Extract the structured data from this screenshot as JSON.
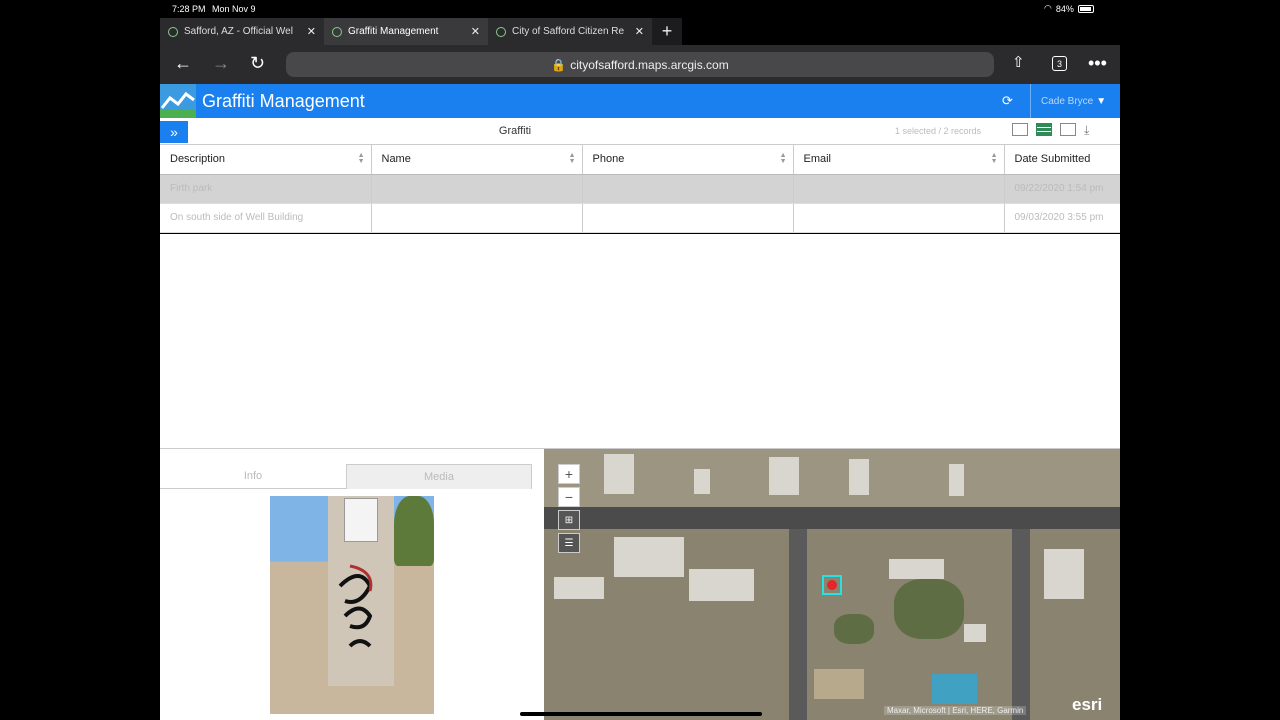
{
  "status": {
    "time": "7:28 PM",
    "date": "Mon Nov 9",
    "battery": "84%"
  },
  "tabs": [
    {
      "label": "Safford, AZ - Official Wel",
      "active": false
    },
    {
      "label": "Graffiti Management",
      "active": true
    },
    {
      "label": "City of Safford Citizen Re",
      "active": false
    }
  ],
  "browser": {
    "url": "cityofsafford.maps.arcgis.com",
    "tab_count": "3"
  },
  "app": {
    "title": "Graffiti Management",
    "user": "Cade Bryce"
  },
  "table": {
    "title": "Graffiti",
    "records": "1 selected / 2 records",
    "columns": [
      "Description",
      "Name",
      "Phone",
      "Email",
      "Date Submitted"
    ],
    "rows": [
      {
        "description": "Firth park",
        "name": "",
        "phone": "",
        "email": "",
        "date": "09/22/2020 1:54 pm",
        "selected": true
      },
      {
        "description": "On south side of Well Building",
        "name": "",
        "phone": "",
        "email": "",
        "date": "09/03/2020 3:55 pm",
        "selected": false
      }
    ]
  },
  "panel": {
    "tabs": [
      "Info",
      "Media"
    ],
    "active_tab": "Media"
  },
  "map": {
    "attribution": "Maxar, Microsoft | Esri, HERE, Garmin",
    "brand": "esri"
  },
  "colors": {
    "header": "#1a80ef",
    "marker": "#e3262c",
    "highlight": "#27e0e0"
  }
}
